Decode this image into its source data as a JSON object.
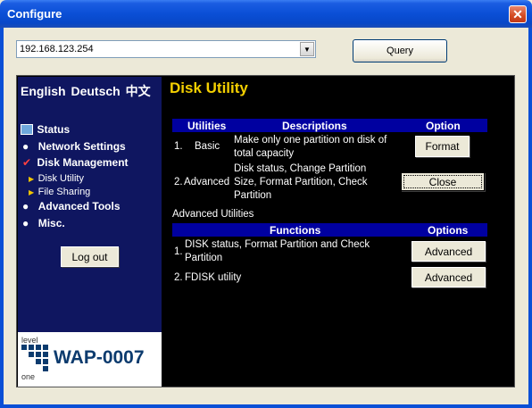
{
  "window": {
    "title": "Configure"
  },
  "address": {
    "value": "192.168.123.254"
  },
  "query_button": "Query",
  "sidebar": {
    "languages": {
      "english": "English",
      "deutsch": "Deutsch",
      "chinese": "中文"
    },
    "nav": {
      "status": "Status",
      "network_settings": "Network Settings",
      "disk_management": "Disk Management",
      "disk_utility": "Disk Utility",
      "file_sharing": "File Sharing",
      "advanced_tools": "Advanced Tools",
      "misc": "Misc."
    },
    "logout": "Log out",
    "logo": {
      "level": "level",
      "one": "one",
      "model": "WAP-0007"
    }
  },
  "content": {
    "title": "Disk Utility",
    "utilities_table": {
      "headers": {
        "utilities": "Utilities",
        "descriptions": "Descriptions",
        "option": "Option"
      },
      "rows": [
        {
          "num": "1.",
          "name": "Basic",
          "description": "Make only one partition on disk of total capacity",
          "button": "Format"
        },
        {
          "num": "2.",
          "name": "Advanced",
          "description": "Disk status, Change Partition Size, Format Partition, Check Partition",
          "button": "Close"
        }
      ]
    },
    "advanced_label": "Advanced Utilities",
    "functions_table": {
      "headers": {
        "functions": "Functions",
        "options": "Options"
      },
      "rows": [
        {
          "num": "1.",
          "function": "DISK status, Format Partition and Check Partition",
          "button": "Advanced"
        },
        {
          "num": "2.",
          "function": "FDISK utility",
          "button": "Advanced"
        }
      ]
    }
  },
  "colors": {
    "title_yellow": "#f4d000",
    "header_blue": "#0000a0",
    "sidebar_navy": "#0f1660",
    "xp_blue": "#0a4fd6"
  }
}
